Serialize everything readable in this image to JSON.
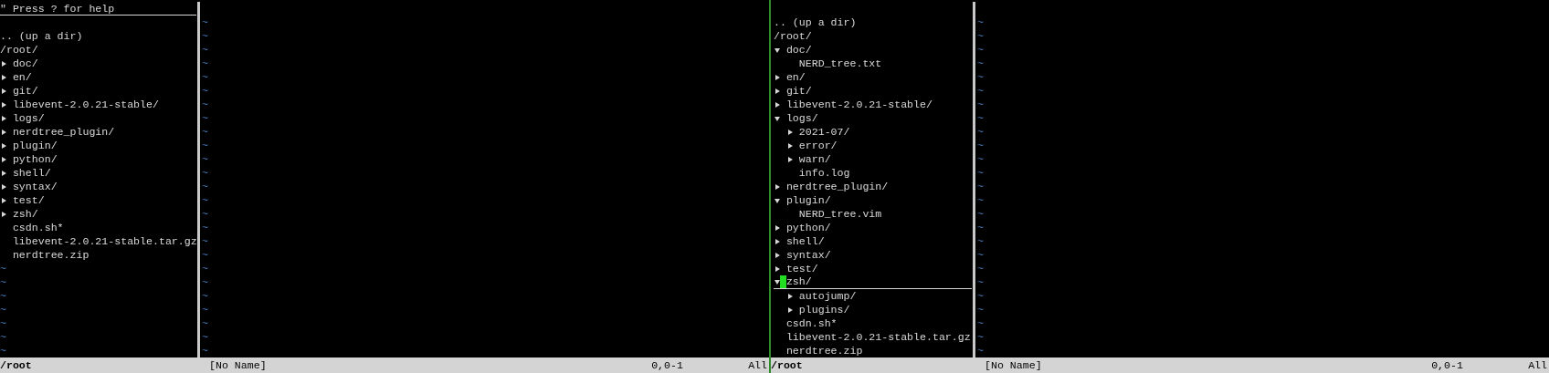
{
  "filler": "~",
  "screens": [
    {
      "help_line": {
        "text": "\" Press ? for help",
        "cursor": true
      },
      "tree": {
        "up_dir": ".. (up a dir)",
        "root": "/root/",
        "items": [
          {
            "name": "doc/",
            "kind": "dir",
            "expanded": false,
            "cursor": false
          },
          {
            "name": "en/",
            "kind": "dir",
            "expanded": false,
            "cursor": false
          },
          {
            "name": "git/",
            "kind": "dir",
            "expanded": false,
            "cursor": false
          },
          {
            "name": "libevent-2.0.21-stable/",
            "kind": "dir",
            "expanded": false,
            "cursor": false
          },
          {
            "name": "logs/",
            "kind": "dir",
            "expanded": false,
            "cursor": false
          },
          {
            "name": "nerdtree_plugin/",
            "kind": "dir",
            "expanded": false,
            "cursor": false
          },
          {
            "name": "plugin/",
            "kind": "dir",
            "expanded": false,
            "cursor": false
          },
          {
            "name": "python/",
            "kind": "dir",
            "expanded": false,
            "cursor": false
          },
          {
            "name": "shell/",
            "kind": "dir",
            "expanded": false,
            "cursor": false
          },
          {
            "name": "syntax/",
            "kind": "dir",
            "expanded": false,
            "cursor": false
          },
          {
            "name": "test/",
            "kind": "dir",
            "expanded": false,
            "cursor": false
          },
          {
            "name": "zsh/",
            "kind": "dir",
            "expanded": false,
            "cursor": false
          },
          {
            "name": "csdn.sh*",
            "kind": "file",
            "cursor": false
          },
          {
            "name": "libevent-2.0.21-stable.tar.gz",
            "kind": "file",
            "cursor": false
          },
          {
            "name": "nerdtree.zip",
            "kind": "file",
            "cursor": false
          }
        ]
      },
      "status": {
        "tree": "/root",
        "file": "[No Name]",
        "position": "0,0-1",
        "scroll": "All"
      }
    },
    {
      "tree": {
        "up_dir": ".. (up a dir)",
        "root": "/root/",
        "items": [
          {
            "name": "doc/",
            "kind": "dir",
            "expanded": true,
            "cursor": false,
            "children": [
              {
                "name": "NERD_tree.txt",
                "kind": "file",
                "cursor": false
              }
            ]
          },
          {
            "name": "en/",
            "kind": "dir",
            "expanded": false,
            "cursor": false
          },
          {
            "name": "git/",
            "kind": "dir",
            "expanded": false,
            "cursor": false
          },
          {
            "name": "libevent-2.0.21-stable/",
            "kind": "dir",
            "expanded": false,
            "cursor": false
          },
          {
            "name": "logs/",
            "kind": "dir",
            "expanded": true,
            "cursor": false,
            "children": [
              {
                "name": "2021-07/",
                "kind": "dir",
                "expanded": false,
                "cursor": false
              },
              {
                "name": "error/",
                "kind": "dir",
                "expanded": false,
                "cursor": false
              },
              {
                "name": "warn/",
                "kind": "dir",
                "expanded": false,
                "cursor": false
              },
              {
                "name": "info.log",
                "kind": "file",
                "cursor": false
              }
            ]
          },
          {
            "name": "nerdtree_plugin/",
            "kind": "dir",
            "expanded": false,
            "cursor": false
          },
          {
            "name": "plugin/",
            "kind": "dir",
            "expanded": true,
            "cursor": false,
            "children": [
              {
                "name": "NERD_tree.vim",
                "kind": "file",
                "cursor": false
              }
            ]
          },
          {
            "name": "python/",
            "kind": "dir",
            "expanded": false,
            "cursor": false
          },
          {
            "name": "shell/",
            "kind": "dir",
            "expanded": false,
            "cursor": false
          },
          {
            "name": "syntax/",
            "kind": "dir",
            "expanded": false,
            "cursor": false
          },
          {
            "name": "test/",
            "kind": "dir",
            "expanded": false,
            "cursor": false
          },
          {
            "name": "zsh/",
            "kind": "dir",
            "expanded": true,
            "cursor": true,
            "children": [
              {
                "name": "autojump/",
                "kind": "dir",
                "expanded": false,
                "cursor": false
              },
              {
                "name": "plugins/",
                "kind": "dir",
                "expanded": false,
                "cursor": false
              }
            ]
          },
          {
            "name": "csdn.sh*",
            "kind": "file",
            "cursor": false
          },
          {
            "name": "libevent-2.0.21-stable.tar.gz",
            "kind": "file",
            "cursor": false
          },
          {
            "name": "nerdtree.zip",
            "kind": "file",
            "cursor": false
          }
        ]
      },
      "status": {
        "tree": "/root",
        "file": "[No Name]",
        "position": "0,0-1",
        "scroll": "All"
      }
    }
  ]
}
